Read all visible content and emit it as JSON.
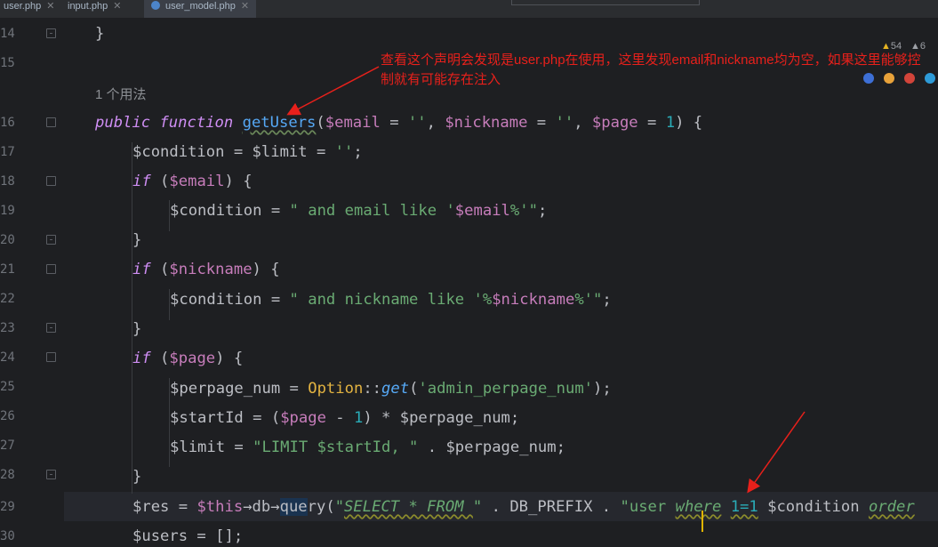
{
  "tabs": [
    {
      "label": "user.php"
    },
    {
      "label": "input.php"
    },
    {
      "label": "user_model.php"
    }
  ],
  "inspections": {
    "warnings_a": "54",
    "warnings_b": "6"
  },
  "usage_hint": "1 个用法",
  "annotation": "查看这个声明会发现是user.php在使用，这里发现email和nickname均为空，如果这里能够控制就有可能存在注入",
  "line_numbers": [
    "14",
    "15",
    "16",
    "17",
    "18",
    "19",
    "20",
    "21",
    "22",
    "23",
    "24",
    "25",
    "26",
    "27",
    "28",
    "29",
    "30"
  ],
  "code": {
    "l14": "}",
    "l16_kw1": "public",
    "l16_kw2": "function",
    "l16_fn": "getUsers",
    "l16_p1": "(",
    "l16_v1": "$email",
    "l16_p2": " = ",
    "l16_s1": "''",
    "l16_p3": ", ",
    "l16_v2": "$nickname",
    "l16_p4": " = ",
    "l16_s2": "''",
    "l16_p5": ", ",
    "l16_v3": "$page",
    "l16_p6": " = ",
    "l16_n1": "1",
    "l16_p7": ") {",
    "l17": "$condition = $limit = ",
    "l17_s": "''",
    "l17_e": ";",
    "l18_kw": "if",
    "l18_p1": " (",
    "l18_v": "$email",
    "l18_p2": ") {",
    "l19_a": "$condition = ",
    "l19_s1": "\" and email like '",
    "l19_v": "$email",
    "l19_s2": "%'\"",
    "l19_e": ";",
    "l20": "}",
    "l21_kw": "if",
    "l21_p1": " (",
    "l21_v": "$nickname",
    "l21_p2": ") {",
    "l22_a": "$condition = ",
    "l22_s1": "\" and nickname like '%",
    "l22_v": "$nickname",
    "l22_s2": "%'\"",
    "l22_e": ";",
    "l23": "}",
    "l24_kw": "if",
    "l24_p1": " (",
    "l24_v": "$page",
    "l24_p2": ") {",
    "l25_a": "$perpage_num = ",
    "l25_c": "Option",
    "l25_b": "::",
    "l25_m": "get",
    "l25_d": "(",
    "l25_s": "'admin_perpage_num'",
    "l25_e": ");",
    "l26_a": "$startId = (",
    "l26_v": "$page",
    "l26_b": " - ",
    "l26_n": "1",
    "l26_c": ") * $perpage_num;",
    "l27_a": "$limit = ",
    "l27_s": "\"LIMIT $startId, \"",
    "l27_b": " . $perpage_num;",
    "l28": "}",
    "l29_a": "$res = ",
    "l29_this": "$this",
    "l29_b": "→db→",
    "l29_q": "que",
    "l29_q2": "ry(",
    "l29_s1": "\"",
    "l29_sel": "SELECT * FROM ",
    "l29_s1e": "\"",
    "l29_c": " . DB_PREFIX . ",
    "l29_s2": "\"user ",
    "l29_where": "where",
    "l29_sp": " ",
    "l29_one": "1=1",
    "l29_s3": " $condition ",
    "l29_order": "order",
    "l30": "$users = [];"
  }
}
